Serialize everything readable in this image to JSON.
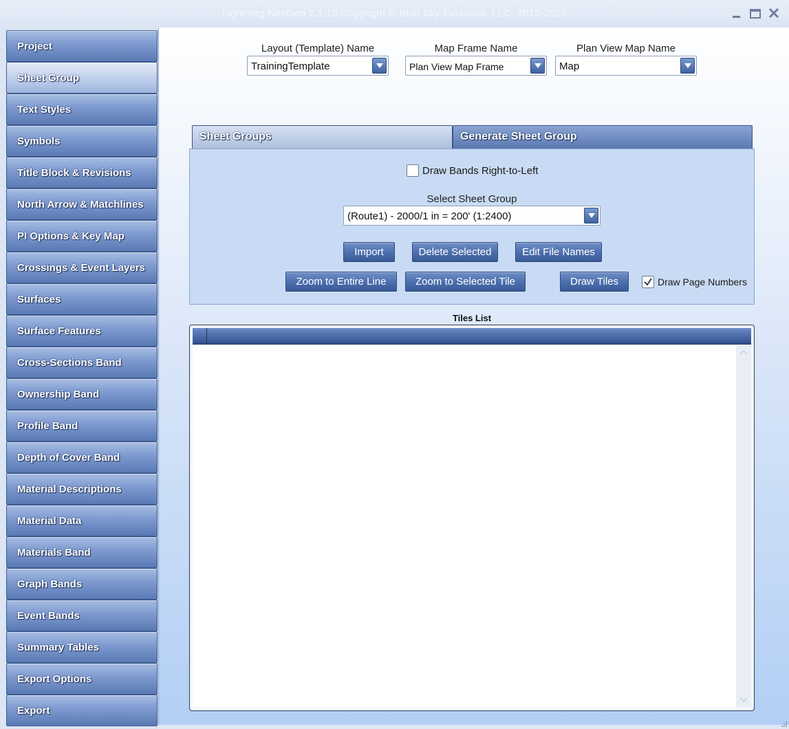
{
  "window": {
    "title": "Lightning NexGen 2.1.10 Copyright © Blue Sky Evolution, LLC, 2019-2025"
  },
  "sidebar": {
    "items": [
      {
        "label": "Project"
      },
      {
        "label": "Sheet Group"
      },
      {
        "label": "Text Styles"
      },
      {
        "label": "Symbols"
      },
      {
        "label": "Title Block & Revisions"
      },
      {
        "label": "North Arrow & Matchlines"
      },
      {
        "label": "PI Options & Key Map"
      },
      {
        "label": "Crossings & Event Layers"
      },
      {
        "label": "Surfaces"
      },
      {
        "label": "Surface Features"
      },
      {
        "label": "Cross-Sections Band"
      },
      {
        "label": "Ownership Band"
      },
      {
        "label": "Profile Band"
      },
      {
        "label": "Depth of Cover Band"
      },
      {
        "label": "Material Descriptions"
      },
      {
        "label": "Material Data"
      },
      {
        "label": "Materials Band"
      },
      {
        "label": "Graph Bands"
      },
      {
        "label": "Event Bands"
      },
      {
        "label": "Summary Tables"
      },
      {
        "label": "Export Options"
      },
      {
        "label": "Export"
      }
    ],
    "active_index": 1
  },
  "header": {
    "layout": {
      "label": "Layout (Template) Name",
      "value": "TrainingTemplate"
    },
    "map_frame": {
      "label": "Map Frame Name",
      "value": "Plan View Map Frame"
    },
    "plan_view": {
      "label": "Plan View Map Name",
      "value": "Map"
    }
  },
  "tabs": [
    {
      "label": "Sheet Groups",
      "active": true
    },
    {
      "label": "Generate Sheet Group",
      "active": false
    }
  ],
  "panel": {
    "draw_bands_rtl": {
      "label": "Draw Bands Right-to-Left",
      "checked": false
    },
    "select_sheet_group": {
      "label": "Select Sheet Group",
      "value": "(Route1) - 2000/1 in = 200' (1:2400)"
    },
    "buttons": {
      "import": "Import",
      "delete_selected": "Delete Selected",
      "edit_file_names": "Edit File Names",
      "zoom_entire_line": "Zoom to Entire Line",
      "zoom_selected_tile": "Zoom to Selected Tile",
      "draw_tiles": "Draw Tiles"
    },
    "draw_page_numbers": {
      "label": "Draw Page Numbers",
      "checked": true
    }
  },
  "tiles_list": {
    "title": "Tiles List",
    "rows": []
  },
  "colors": {
    "nav_button": "#6f8cc6",
    "accent_dark": "#2f4f8c",
    "panel_bg": "#c9dbf4"
  }
}
